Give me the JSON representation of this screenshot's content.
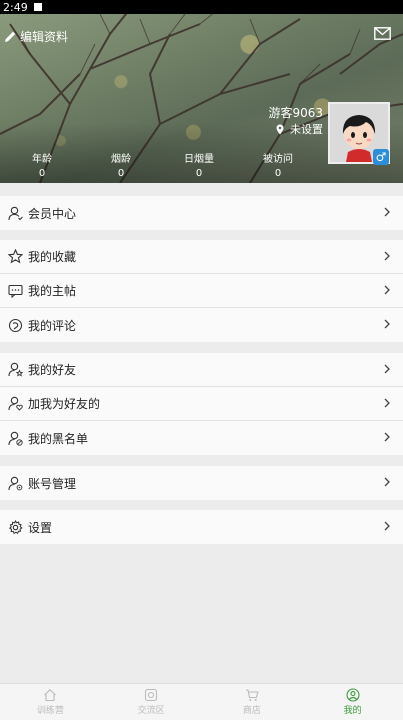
{
  "status_bar": {
    "time": "2:49"
  },
  "header": {
    "edit_label": "编辑资料",
    "username": "游客9063",
    "location": "未设置",
    "gender_symbol": "♂",
    "stats": [
      {
        "label": "年龄",
        "value": "0"
      },
      {
        "label": "烟龄",
        "value": "0"
      },
      {
        "label": "日烟量",
        "value": "0"
      },
      {
        "label": "被访问",
        "value": "0"
      }
    ]
  },
  "menu": {
    "member_center": "会员中心",
    "my_favorites": "我的收藏",
    "my_posts": "我的主帖",
    "my_comments": "我的评论",
    "my_friends": "我的好友",
    "added_me": "加我为好友的",
    "my_blacklist": "我的黑名单",
    "account_mgmt": "账号管理",
    "settings": "设置"
  },
  "bottom_nav": {
    "items": [
      {
        "label": "训练营",
        "icon": "home-icon"
      },
      {
        "label": "交流区",
        "icon": "chat-box-icon"
      },
      {
        "label": "商店",
        "icon": "cart-icon"
      },
      {
        "label": "我的",
        "icon": "profile-icon"
      }
    ],
    "active_index": 3,
    "active_color": "#3c9a3c"
  }
}
